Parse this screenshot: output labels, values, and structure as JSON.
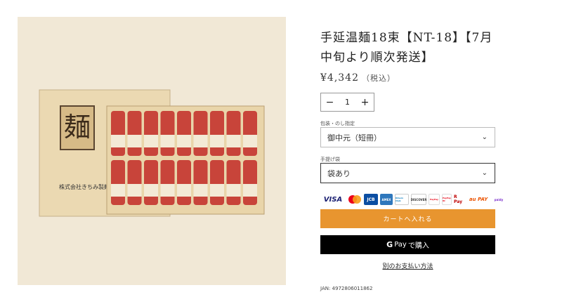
{
  "product": {
    "title": "手延温麺18束【NT-18】【7月中旬より順次発送】",
    "price": "¥4,342",
    "tax_note": "（税込）",
    "image_box_label": "麺",
    "image_brand_text": "株式会社きちみ製麺"
  },
  "quantity": {
    "minus": "−",
    "value": "1",
    "plus": "+"
  },
  "options": [
    {
      "label": "包装・のし指定",
      "value": "御中元（短冊）"
    },
    {
      "label": "手提げ袋",
      "value": "袋あり"
    }
  ],
  "payment_icons": [
    "VISA",
    "mastercard",
    "JCB",
    "AMEX",
    "Diners Club",
    "DISCOVER",
    "PayPay",
    "PayPay ID",
    "R Pay",
    "au PAY",
    "paidy"
  ],
  "buttons": {
    "add_to_cart": "カートへ入れる",
    "gpay_label": "Pay",
    "gpay_suffix": "で購入",
    "more_payment": "別のお支払い方法"
  },
  "jan": "JAN: 4972806011862",
  "colors": {
    "cart_button": "#e8952f",
    "gpay_button": "#000000",
    "image_bg": "#f1e8d6"
  }
}
